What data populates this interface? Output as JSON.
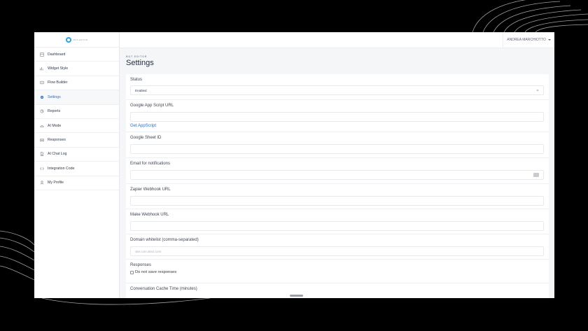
{
  "colors": {
    "accent": "#2a6fdb",
    "logo": "#29a3e6",
    "backdrop": "#000000"
  },
  "sidebar": {
    "logo_text": "BOT EDITOR",
    "items": [
      {
        "label": "Dashboard",
        "icon": "dashboard-icon"
      },
      {
        "label": "Widget Style",
        "icon": "chart-icon"
      },
      {
        "label": "Flow Builder",
        "icon": "flow-icon"
      },
      {
        "label": "Settings",
        "icon": "gear-icon",
        "active": true
      },
      {
        "label": "Reports",
        "icon": "reports-icon"
      },
      {
        "label": "AI Mode",
        "icon": "ai-icon"
      },
      {
        "label": "Responses",
        "icon": "inbox-icon"
      },
      {
        "label": "AI Chat Log",
        "icon": "document-icon"
      },
      {
        "label": "Integration Code",
        "icon": "code-icon"
      },
      {
        "label": "My Profile",
        "icon": "user-icon"
      }
    ]
  },
  "header": {
    "user_name": "ANDREA MARCHIOTTO"
  },
  "page": {
    "eyebrow": "BOT EDITOR",
    "title": "Settings"
  },
  "form": {
    "status": {
      "label": "Status",
      "value": "Enabled"
    },
    "google_app_script": {
      "label": "Google App Script URL",
      "value": "",
      "link": "Get AppScript"
    },
    "google_sheet_id": {
      "label": "Google Sheet ID",
      "value": ""
    },
    "email": {
      "label": "Email for notifications",
      "value": ""
    },
    "zapier": {
      "label": "Zapier Webhook URL",
      "value": ""
    },
    "make": {
      "label": "Make Webhook URL",
      "value": ""
    },
    "domain_whitelist": {
      "label": "Domain whitelist (comma-separated)",
      "placeholder": "site.com,site2.com"
    },
    "responses": {
      "label": "Responses",
      "checkbox_label": "Do not save responses",
      "checked": false
    },
    "cache_time": {
      "label": "Conversation Cache Time (minutes)"
    }
  }
}
